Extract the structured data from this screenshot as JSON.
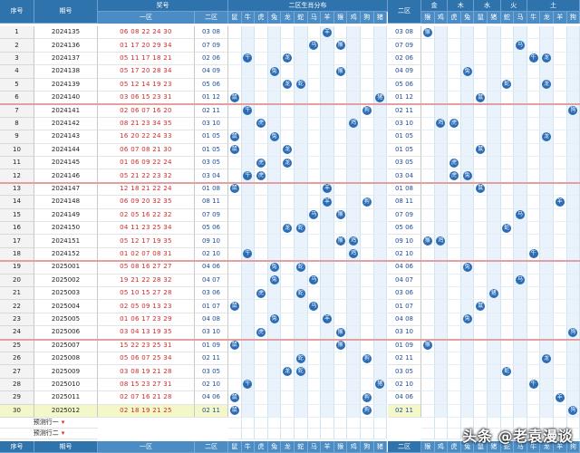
{
  "header": {
    "seq": "序号",
    "period": "期号",
    "sort_hint": "顺/逆",
    "prize": "奖号",
    "zone1": "一区",
    "zone2": "二区",
    "dist": "二区生肖分布",
    "zone2b": "二区",
    "zodiac": [
      "鼠",
      "牛",
      "虎",
      "兔",
      "龙",
      "蛇",
      "马",
      "羊",
      "猴",
      "鸡",
      "狗",
      "猪"
    ],
    "elements": [
      "金",
      "木",
      "水",
      "火",
      "土"
    ],
    "elem_zodiac": [
      "猴",
      "鸡",
      "虎",
      "兔",
      "鼠",
      "猪",
      "蛇",
      "马",
      "牛",
      "龙",
      "羊",
      "狗"
    ]
  },
  "rows": [
    {
      "seq": "1",
      "period": "2024135",
      "z1": "06 08 22 24 30",
      "z2": "03 08",
      "a": [
        7
      ],
      "b": [
        0
      ]
    },
    {
      "seq": "2",
      "period": "2024136",
      "z1": "01 17 20 29 34",
      "z2": "07 09",
      "a": [
        6,
        8
      ],
      "b": [
        7
      ]
    },
    {
      "seq": "3",
      "period": "2024137",
      "z1": "05 11 17 18 21",
      "z2": "02 06",
      "a": [
        1,
        4
      ],
      "b": [
        8,
        9
      ]
    },
    {
      "seq": "4",
      "period": "2024138",
      "z1": "05 17 20 28 34",
      "z2": "04 09",
      "a": [
        3,
        8
      ],
      "b": [
        3
      ]
    },
    {
      "seq": "5",
      "period": "2024139",
      "z1": "05 12 14 19 23",
      "z2": "05 06",
      "a": [
        4,
        5
      ],
      "b": [
        6,
        9
      ]
    },
    {
      "seq": "6",
      "period": "2024140",
      "z1": "03 06 15 23 31",
      "z2": "01 12",
      "a": [
        0,
        11
      ],
      "b": [
        4
      ]
    },
    {
      "seq": "7",
      "period": "2024141",
      "z1": "02 06 07 16 20",
      "z2": "02 11",
      "a": [
        1,
        10
      ],
      "b": [
        11
      ]
    },
    {
      "seq": "8",
      "period": "2024142",
      "z1": "08 21 23 34 35",
      "z2": "03 10",
      "a": [
        2,
        9
      ],
      "b": [
        1,
        2
      ]
    },
    {
      "seq": "9",
      "period": "2024143",
      "z1": "16 20 22 24 33",
      "z2": "01 05",
      "a": [
        0,
        3
      ],
      "b": [
        9
      ]
    },
    {
      "seq": "10",
      "period": "2024144",
      "z1": "06 07 08 21 30",
      "z2": "01 05",
      "a": [
        0,
        4
      ],
      "b": [
        4
      ]
    },
    {
      "seq": "11",
      "period": "2024145",
      "z1": "01 06 09 22 24",
      "z2": "03 05",
      "a": [
        2,
        4
      ],
      "b": [
        2
      ]
    },
    {
      "seq": "12",
      "period": "2024146",
      "z1": "05 21 22 23 32",
      "z2": "03 04",
      "a": [
        2,
        1
      ],
      "b": [
        2,
        3
      ]
    },
    {
      "seq": "13",
      "period": "2024147",
      "z1": "12 18 21 22 24",
      "z2": "01 08",
      "a": [
        0,
        7
      ],
      "b": [
        4
      ]
    },
    {
      "seq": "14",
      "period": "2024148",
      "z1": "06 09 20 32 35",
      "z2": "08 11",
      "a": [
        7,
        10
      ],
      "b": [
        10
      ]
    },
    {
      "seq": "15",
      "period": "2024149",
      "z1": "02 05 16 22 32",
      "z2": "07 09",
      "a": [
        6,
        8
      ],
      "b": [
        7
      ]
    },
    {
      "seq": "16",
      "period": "2024150",
      "z1": "04 11 23 25 34",
      "z2": "05 06",
      "a": [
        4,
        5
      ],
      "b": [
        6
      ]
    },
    {
      "seq": "17",
      "period": "2024151",
      "z1": "05 12 17 19 35",
      "z2": "09 10",
      "a": [
        8,
        9
      ],
      "b": [
        0,
        1
      ]
    },
    {
      "seq": "18",
      "period": "2024152",
      "z1": "01 02 07 08 31",
      "z2": "02 10",
      "a": [
        1,
        9
      ],
      "b": [
        8
      ]
    },
    {
      "seq": "19",
      "period": "2025001",
      "z1": "05 08 16 27 27",
      "z2": "04 06",
      "a": [
        3,
        5
      ],
      "b": [
        3
      ]
    },
    {
      "seq": "20",
      "period": "2025002",
      "z1": "19 21 22 28 32",
      "z2": "04 07",
      "a": [
        3,
        6
      ],
      "b": [
        7
      ]
    },
    {
      "seq": "21",
      "period": "2025003",
      "z1": "05 10 15 27 28",
      "z2": "03 06",
      "a": [
        2,
        5
      ],
      "b": [
        5
      ]
    },
    {
      "seq": "22",
      "period": "2025004",
      "z1": "02 05 09 13 23",
      "z2": "01 07",
      "a": [
        0,
        6
      ],
      "b": [
        4
      ]
    },
    {
      "seq": "23",
      "period": "2025005",
      "z1": "01 06 17 23 29",
      "z2": "04 08",
      "a": [
        3,
        7
      ],
      "b": [
        3
      ]
    },
    {
      "seq": "24",
      "period": "2025006",
      "z1": "03 04 13 19 35",
      "z2": "03 10",
      "a": [
        2,
        8
      ],
      "b": [
        11
      ]
    },
    {
      "seq": "25",
      "period": "2025007",
      "z1": "15 22 23 25 31",
      "z2": "01 09",
      "a": [
        0,
        8
      ],
      "b": [
        0
      ]
    },
    {
      "seq": "26",
      "period": "2025008",
      "z1": "05 06 07 25 34",
      "z2": "02 11",
      "a": [
        5,
        10
      ],
      "b": [
        9
      ]
    },
    {
      "seq": "27",
      "period": "2025009",
      "z1": "03 08 19 21 28",
      "z2": "03 05",
      "a": [
        4,
        5
      ],
      "b": [
        6
      ]
    },
    {
      "seq": "28",
      "period": "2025010",
      "z1": "08 15 23 27 31",
      "z2": "02 10",
      "a": [
        1,
        11
      ],
      "b": [
        8
      ]
    },
    {
      "seq": "29",
      "period": "2025011",
      "z1": "02 07 16 21 28",
      "z2": "04 06",
      "a": [
        0,
        10
      ],
      "b": [
        10
      ]
    },
    {
      "seq": "30",
      "period": "2025012",
      "z1": "02 18 19 21 25",
      "z2": "02 11",
      "a": [
        0,
        10
      ],
      "b": [
        11
      ]
    }
  ],
  "predict": [
    "预测行一",
    "预测行二"
  ],
  "watermark": "头条 @老袁漫谈"
}
